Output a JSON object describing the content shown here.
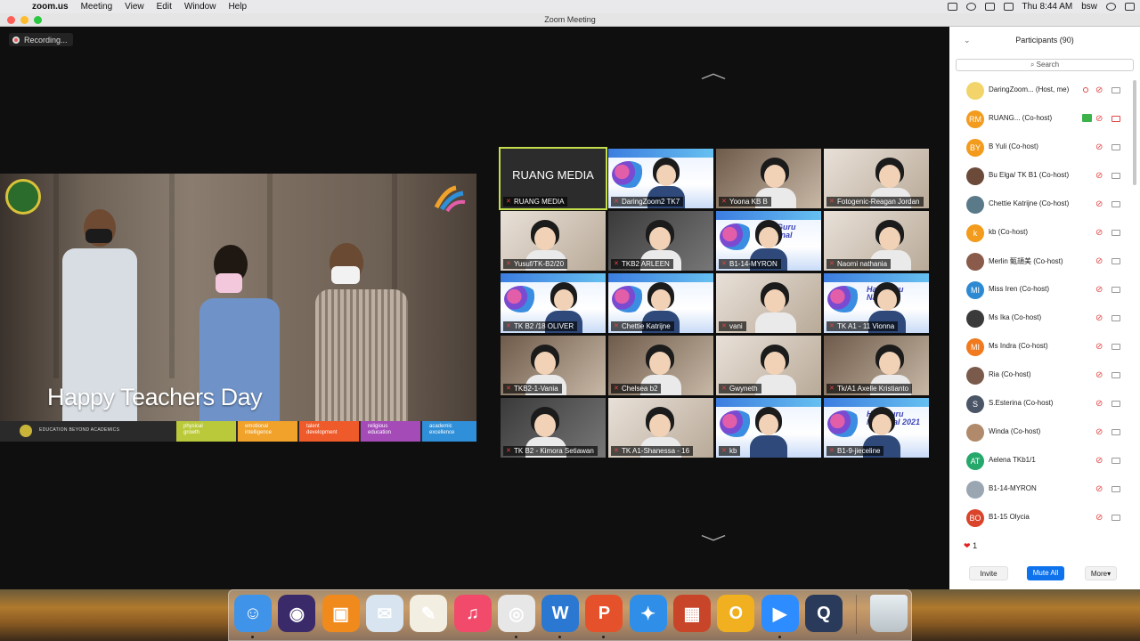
{
  "menubar": {
    "app_name": "zoom.us",
    "menus": [
      "Meeting",
      "View",
      "Edit",
      "Window",
      "Help"
    ],
    "clock": "Thu 8:44 AM",
    "user": "bsw"
  },
  "window": {
    "title": "Zoom Meeting"
  },
  "recording": {
    "label": "Recording..."
  },
  "shared_video": {
    "caption": "Happy Teachers Day",
    "footer_text": "EDUCATION BEYOND ACADEMICS",
    "pillars": [
      {
        "line1": "physical",
        "line2": "growth",
        "color": "#b9c93a"
      },
      {
        "line1": "emotional",
        "line2": "intelligence",
        "color": "#f0a22a"
      },
      {
        "line1": "talent",
        "line2": "development",
        "color": "#ef5a2a"
      },
      {
        "line1": "religious",
        "line2": "education",
        "color": "#a44bb8"
      },
      {
        "line1": "academic",
        "line2": "excellence",
        "color": "#2f8fd8"
      }
    ]
  },
  "gallery": {
    "tiles": [
      {
        "name": "RUANG MEDIA",
        "label": "RUANG MEDIA",
        "style": "name",
        "active": true
      },
      {
        "name": "DaringZoom2 TK7",
        "style": "banner"
      },
      {
        "name": "Yoona KB B",
        "style": "room"
      },
      {
        "name": "Fotogenic-Reagan Jordan",
        "style": "light"
      },
      {
        "name": "Yusuf/TK-B2/20",
        "style": "light"
      },
      {
        "name": "TKB2 ARLEEN",
        "style": "dark"
      },
      {
        "name": "B1-14-MYRON",
        "style": "banner",
        "banner_title": "Hari Guru Nasional"
      },
      {
        "name": "Naomi nathania",
        "style": "light"
      },
      {
        "name": "TK B2 /18 OLIVER",
        "style": "banner"
      },
      {
        "name": "Chettie Katrijne",
        "style": "banner"
      },
      {
        "name": "vani",
        "style": "light"
      },
      {
        "name": "TK A1 - 11 Vionna",
        "style": "banner",
        "banner_title": "Hari Guru Nasional"
      },
      {
        "name": "TKB2-1-Vania",
        "style": "room"
      },
      {
        "name": "Chelsea b2",
        "style": "room"
      },
      {
        "name": "Gwyneth",
        "style": "light"
      },
      {
        "name": "Tk/A1 Axelle Kristianto",
        "style": "room"
      },
      {
        "name": "TK B2 - Kimora Setiawan",
        "style": "dark"
      },
      {
        "name": "TK A1-Shanessa - 16",
        "style": "light"
      },
      {
        "name": "kb",
        "style": "banner"
      },
      {
        "name": "B1-9-jieceline",
        "style": "banner",
        "banner_title": "Hari Guru Nasional 2021"
      }
    ]
  },
  "participants": {
    "title": "Participants (90)",
    "search_placeholder": "Search",
    "list": [
      {
        "avatar": "",
        "avatar_color": "#f2d46b",
        "name": "DaringZoom... (Host, me)",
        "rec": true,
        "cam_off": false
      },
      {
        "avatar": "RM",
        "avatar_color": "#f29b1d",
        "name": "RUANG...   (Co-host)",
        "share": true,
        "cam_off": true
      },
      {
        "avatar": "BY",
        "avatar_color": "#f29b1d",
        "name": "B Yuli (Co-host)"
      },
      {
        "avatar": "",
        "avatar_color": "#6b4a3a",
        "name": "Bu Elga/ TK B1 (Co-host)"
      },
      {
        "avatar": "",
        "avatar_color": "#5a7a8a",
        "name": "Chettie Katrijne (Co-host)"
      },
      {
        "avatar": "k",
        "avatar_color": "#f29b1d",
        "name": "kb (Co-host)"
      },
      {
        "avatar": "",
        "avatar_color": "#8a5a4a",
        "name": "Merlin 甄頡美 (Co-host)"
      },
      {
        "avatar": "MI",
        "avatar_color": "#2d8ad2",
        "name": "Miss Iren (Co-host)"
      },
      {
        "avatar": "",
        "avatar_color": "#3a3a3a",
        "name": "Ms Ika (Co-host)"
      },
      {
        "avatar": "MI",
        "avatar_color": "#f07a1d",
        "name": "Ms Indra (Co-host)"
      },
      {
        "avatar": "",
        "avatar_color": "#7a5a4a",
        "name": "Ria (Co-host)"
      },
      {
        "avatar": "S",
        "avatar_color": "#4a5566",
        "name": "S.Esterina (Co-host)"
      },
      {
        "avatar": "",
        "avatar_color": "#b08a6a",
        "name": "Winda (Co-host)"
      },
      {
        "avatar": "AT",
        "avatar_color": "#25a86b",
        "name": "Aelena TKb1/1"
      },
      {
        "avatar": "",
        "avatar_color": "#9aa6b2",
        "name": "B1-14-MYRON"
      },
      {
        "avatar": "BO",
        "avatar_color": "#d9442a",
        "name": "B1-15 Olycia"
      }
    ],
    "reaction_count": "1",
    "buttons": {
      "invite": "Invite",
      "mute_all": "Mute All",
      "more": "More"
    }
  },
  "dock": {
    "apps": [
      {
        "icon": "finder-icon",
        "color": "#3f93e8",
        "glyph": "☺",
        "running": true
      },
      {
        "icon": "siri-icon",
        "color": "#3a2a6a",
        "glyph": "◉"
      },
      {
        "icon": "books-icon",
        "color": "#f08a1c",
        "glyph": "▣"
      },
      {
        "icon": "mail-icon",
        "color": "#d8e4ef",
        "glyph": "✉"
      },
      {
        "icon": "textedit-icon",
        "color": "#f2efe2",
        "glyph": "✎"
      },
      {
        "icon": "music-icon",
        "color": "#f24a6a",
        "glyph": "♫"
      },
      {
        "icon": "chrome-icon",
        "color": "#e7e7e7",
        "glyph": "◎",
        "running": true
      },
      {
        "icon": "word-icon",
        "color": "#2b78d2",
        "glyph": "W",
        "running": true
      },
      {
        "icon": "powerpoint-icon",
        "color": "#e5512a",
        "glyph": "P",
        "running": true
      },
      {
        "icon": "safari-icon",
        "color": "#2f8fe8",
        "glyph": "✦"
      },
      {
        "icon": "photo-booth-icon",
        "color": "#c8452a",
        "glyph": "▦"
      },
      {
        "icon": "opera-icon",
        "color": "#f0b020",
        "glyph": "O"
      },
      {
        "icon": "zoom-icon",
        "color": "#2d8cff",
        "glyph": "▶",
        "running": true
      },
      {
        "icon": "quicktime-icon",
        "color": "#2a3a5a",
        "glyph": "Q"
      }
    ],
    "trash_icon": "trash-icon"
  }
}
